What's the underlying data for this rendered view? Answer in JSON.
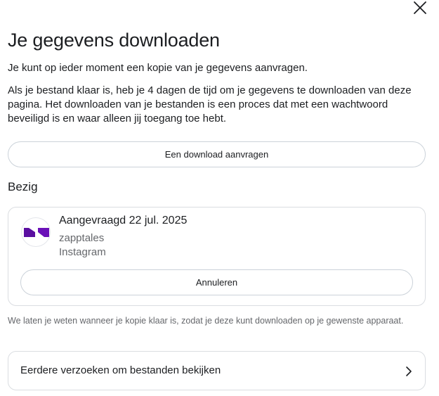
{
  "header": {
    "title": "Je gegevens downloaden",
    "subtitle": "Je kunt op ieder moment een kopie van je gegevens aanvragen.",
    "description": "Als je bestand klaar is, heb je 4 dagen de tijd om je gegevens te downloaden van deze pagina. Het downloaden van je bestanden is een proces dat met een wachtwoord beveiligd is en waar alleen jij toegang toe hebt."
  },
  "actions": {
    "request_label": "Een download aanvragen",
    "close_icon": "close-icon"
  },
  "busy": {
    "section_title": "Bezig",
    "request": {
      "date_label": "Aangevraagd 22 jul. 2025",
      "username": "zapptales",
      "app": "Instagram",
      "cancel_label": "Annuleren",
      "avatar_colors": [
        "#5a0ea0",
        "#7a16c8"
      ]
    }
  },
  "note": "We laten je weten wanneer je kopie klaar is, zodat je deze kunt downloaden op je gewenste apparaat.",
  "previous": {
    "label": "Eerdere verzoeken om bestanden bekijken",
    "icon": "chevron-right-icon"
  }
}
